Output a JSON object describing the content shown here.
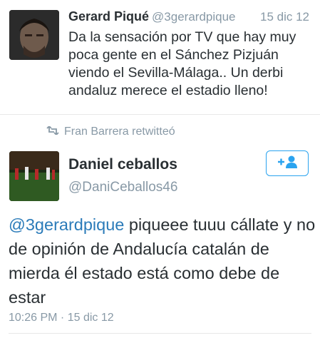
{
  "tweet1": {
    "name": "Gerard Piqué",
    "handle": "@3gerardpique",
    "date": "15 dic 12",
    "text": "Da la sensación por TV que hay muy poca gente en el Sánchez Pizjuán viendo el Sevilla-Málaga.. Un derbi andaluz merece el estadio lleno!"
  },
  "retweet": {
    "text": "Fran Barrera retwitteó",
    "icon": "retweet-icon"
  },
  "tweet2": {
    "name": "Daniel ceballos",
    "handle": "@DaniCeballos46",
    "follow_icon": "follow-user-icon",
    "mention": "@3gerardpique",
    "text": " piqueee tuuu cállate y no de opinión de Andalucía catalán de mierda  él estado está como debe de estar",
    "time": "10:26 PM · 15 dic 12"
  },
  "colors": {
    "link": "#2b7bb9",
    "follow_blue": "#2aa3ef",
    "muted": "#8899a6",
    "text": "#292f33"
  }
}
